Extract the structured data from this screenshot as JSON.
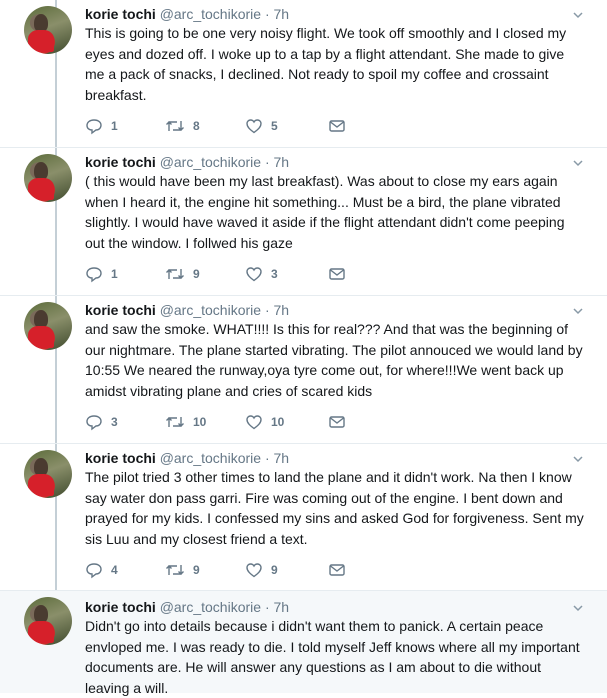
{
  "tweets": [
    {
      "name": "korie tochi",
      "handle": "@arc_tochikorie",
      "dot": "·",
      "time": "7h",
      "text": "This is going to be one very noisy flight. We took off smoothly and I closed my eyes and dozed off. I woke up to a tap by a flight attendant. She made to give me a pack of snacks, I declined. Not ready to spoil my coffee and crossaint breakfast.",
      "replies": "1",
      "retweets": "8",
      "likes": "5"
    },
    {
      "name": "korie tochi",
      "handle": "@arc_tochikorie",
      "dot": "·",
      "time": "7h",
      "text": "( this would have been my last breakfast). Was about to close my ears again when I heard it, the engine hit something... Must be a bird, the plane vibrated slightly. I would have waved it aside if the flight attendant didn't come peeping out the window. I follwed his gaze",
      "replies": "1",
      "retweets": "9",
      "likes": "3"
    },
    {
      "name": "korie tochi",
      "handle": "@arc_tochikorie",
      "dot": "·",
      "time": "7h",
      "text": "and saw the smoke. WHAT!!!! Is this for real??? And that was the beginning of our nightmare. The plane started vibrating. The pilot annouced we would land by 10:55 We neared the runway,oya tyre come out, for where!!!We went back up amidst vibrating plane and cries of scared kids",
      "replies": "3",
      "retweets": "10",
      "likes": "10"
    },
    {
      "name": "korie tochi",
      "handle": "@arc_tochikorie",
      "dot": "·",
      "time": "7h",
      "text": "The pilot tried 3 other times to land the plane and it didn't work. Na then I know say water don pass garri. Fire was coming out of the engine. I bent down and prayed for my kids. I confessed my sins and asked God for forgiveness. Sent my sis Luu and my closest friend a text.",
      "replies": "4",
      "retweets": "9",
      "likes": "9"
    },
    {
      "name": "korie tochi",
      "handle": "@arc_tochikorie",
      "dot": "·",
      "time": "7h",
      "text": "Didn't go into details because i didn't want them to panick. A certain peace envloped me. I was ready to die. I told myself Jeff knows where all my important documents are. He will answer any questions as I am about to die without leaving a will.",
      "replies": "",
      "retweets": "",
      "likes": ""
    }
  ],
  "icons": {
    "reply": "reply-icon",
    "retweet": "retweet-icon",
    "like": "heart-icon",
    "message": "envelope-icon",
    "caret": "chevron-down-icon"
  },
  "colors": {
    "icon_gray": "#657786",
    "thread_line": "#c4cfd6",
    "highlight_bg": "#f5f8fa"
  }
}
